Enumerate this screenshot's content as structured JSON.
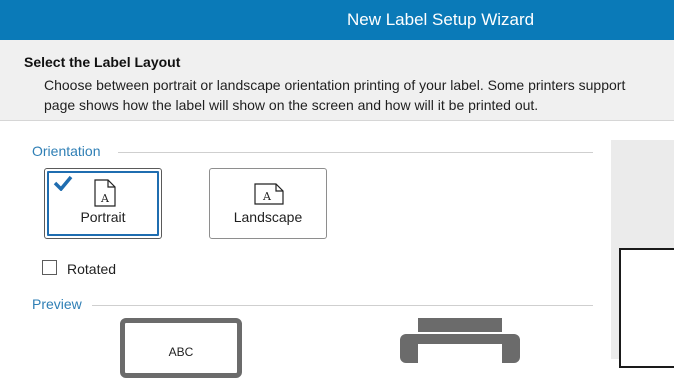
{
  "window": {
    "title": "New Label Setup Wizard"
  },
  "header": {
    "heading": "Select the Label Layout",
    "description_line1": "Choose between portrait or landscape orientation printing of your label. Some printers support",
    "description_line2": "page shows how the label will show on the screen and how will it be printed out."
  },
  "orientation": {
    "section_label": "Orientation",
    "options": [
      {
        "label": "Portrait",
        "selected": true,
        "icon": "portrait-page-icon"
      },
      {
        "label": "Landscape",
        "selected": false,
        "icon": "landscape-page-icon"
      }
    ],
    "rotated": {
      "label": "Rotated",
      "checked": false
    }
  },
  "preview": {
    "section_label": "Preview",
    "screen_text": "ABC",
    "icons": [
      "screen-preview-icon",
      "printer-icon"
    ]
  },
  "colors": {
    "titlebar": "#0a7ab8",
    "accent": "#1f6db0",
    "section_label": "#2f7fb5"
  }
}
